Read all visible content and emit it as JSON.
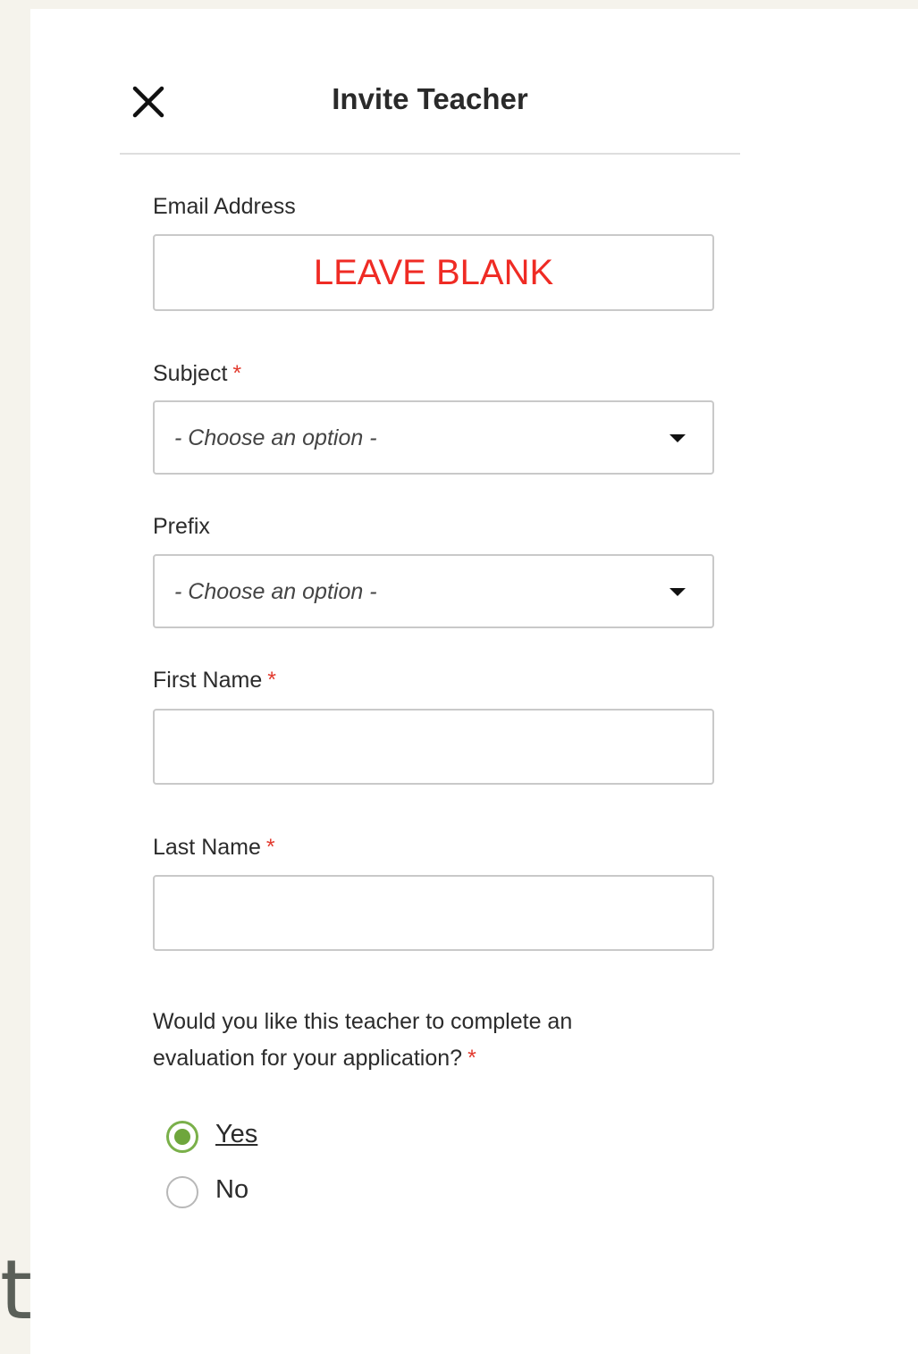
{
  "dialog": {
    "title": "Invite Teacher"
  },
  "form": {
    "email": {
      "label": "Email Address",
      "placeholder": "LEAVE BLANK",
      "value": ""
    },
    "subject": {
      "label": "Subject",
      "required_mark": "*",
      "selected": "- Choose an option -"
    },
    "prefix": {
      "label": "Prefix",
      "selected": "- Choose an option -"
    },
    "first_name": {
      "label": "First Name",
      "required_mark": "*",
      "value": ""
    },
    "last_name": {
      "label": "Last Name",
      "required_mark": "*",
      "value": ""
    },
    "evaluation": {
      "question": "Would you like this teacher to complete an evaluation for your application?",
      "required_mark": "*",
      "options": [
        {
          "label": "Yes",
          "selected": true
        },
        {
          "label": "No",
          "selected": false
        }
      ]
    }
  },
  "background_text": "t",
  "colors": {
    "accent_green": "#6ea63c",
    "required_red": "#e23a2e",
    "placeholder_red": "#ef2b24"
  }
}
